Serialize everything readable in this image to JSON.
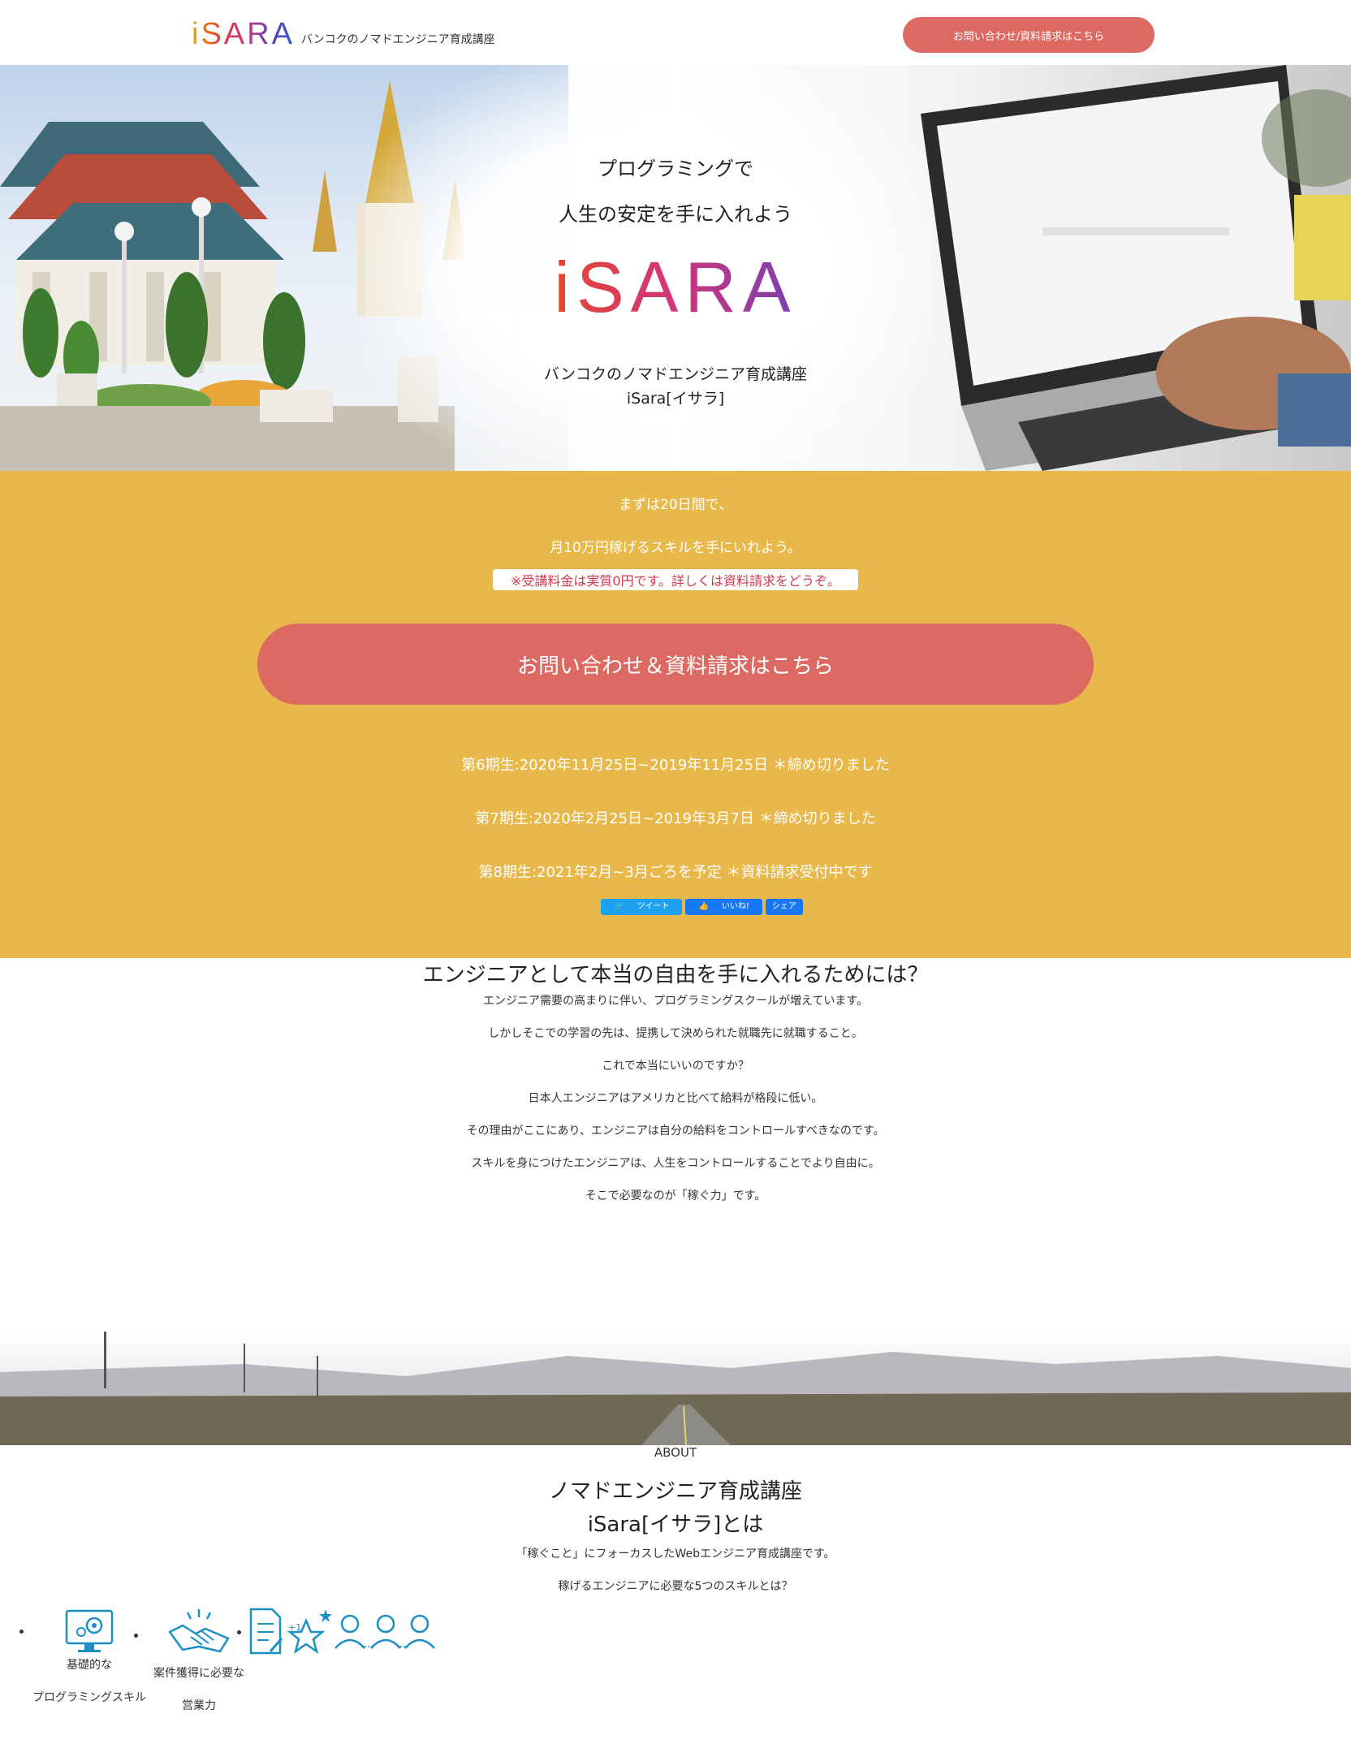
{
  "header": {
    "logo_text": "iSARA",
    "tagline": "バンコクのノマドエンジニア育成講座",
    "cta_label": "お問い合わせ/資料請求はこちら"
  },
  "hero": {
    "line1": "プログラミングで",
    "line2": "人生の安定を手に入れよう",
    "logo_text": "iSARA",
    "sub1": "バンコクのノマドエンジニア育成講座",
    "sub2": "iSara[イサラ]"
  },
  "band": {
    "line1": "まずは20日間で、",
    "line2": "月10万円稼げるスキルを手にいれよう。",
    "note": "※受講料金は実質0円です。詳しくは資料請求をどうぞ。",
    "cta_label": "お問い合わせ＆資料請求はこちら",
    "cohorts": [
      "第6期生:2020年11月25日~2019年11月25日 ＊締め切りました",
      "第7期生:2020年2月25日~2019年3月7日 ＊締め切りました",
      "第8期生:2021年2月~3月ごろを予定 ＊資料請求受付中です"
    ],
    "social": {
      "tweet": "ツイート",
      "like": "いいね!",
      "share": "シェア"
    }
  },
  "freedom": {
    "title": "エンジニアとして本当の自由を手に入れるためには？",
    "paragraphs": [
      "エンジニア需要の高まりに伴い、プログラミングスクールが増えています。",
      "しかしそこでの学習の先は、提携して決められた就職先に就職すること。",
      "これで本当にいいのですか？",
      "日本人エンジニアはアメリカと比べて給料が格段に低い。",
      "その理由がここにあり、エンジニアは自分の給料をコントロールすべきなのです。",
      "スキルを身につけたエンジニアは、人生をコントロールすることでより自由に。",
      "そこで必要なのが「稼ぐ力」です。"
    ]
  },
  "about": {
    "label": "ABOUT",
    "title1": "ノマドエンジニア育成講座",
    "title2": "iSara[イサラ]とは",
    "p1": "「稼ぐこと」にフォーカスしたWebエンジニア育成講座です。",
    "p2": "稼げるエンジニアに必要な5つのスキルとは？",
    "skills": [
      {
        "line1": "基礎的な",
        "line2": "プログラミングスキル",
        "icon": "monitor-gear-icon"
      },
      {
        "line1": "案件獲得に必要な",
        "line2": "営業力",
        "icon": "handshake-icon"
      },
      {
        "line1": "",
        "line2": "",
        "icon": "document-star-people-icon"
      }
    ]
  },
  "colors": {
    "accent": "#dd6a62",
    "band": "#e9b84b",
    "note_text": "#cf3b4f",
    "icon": "#1b8fc6"
  }
}
